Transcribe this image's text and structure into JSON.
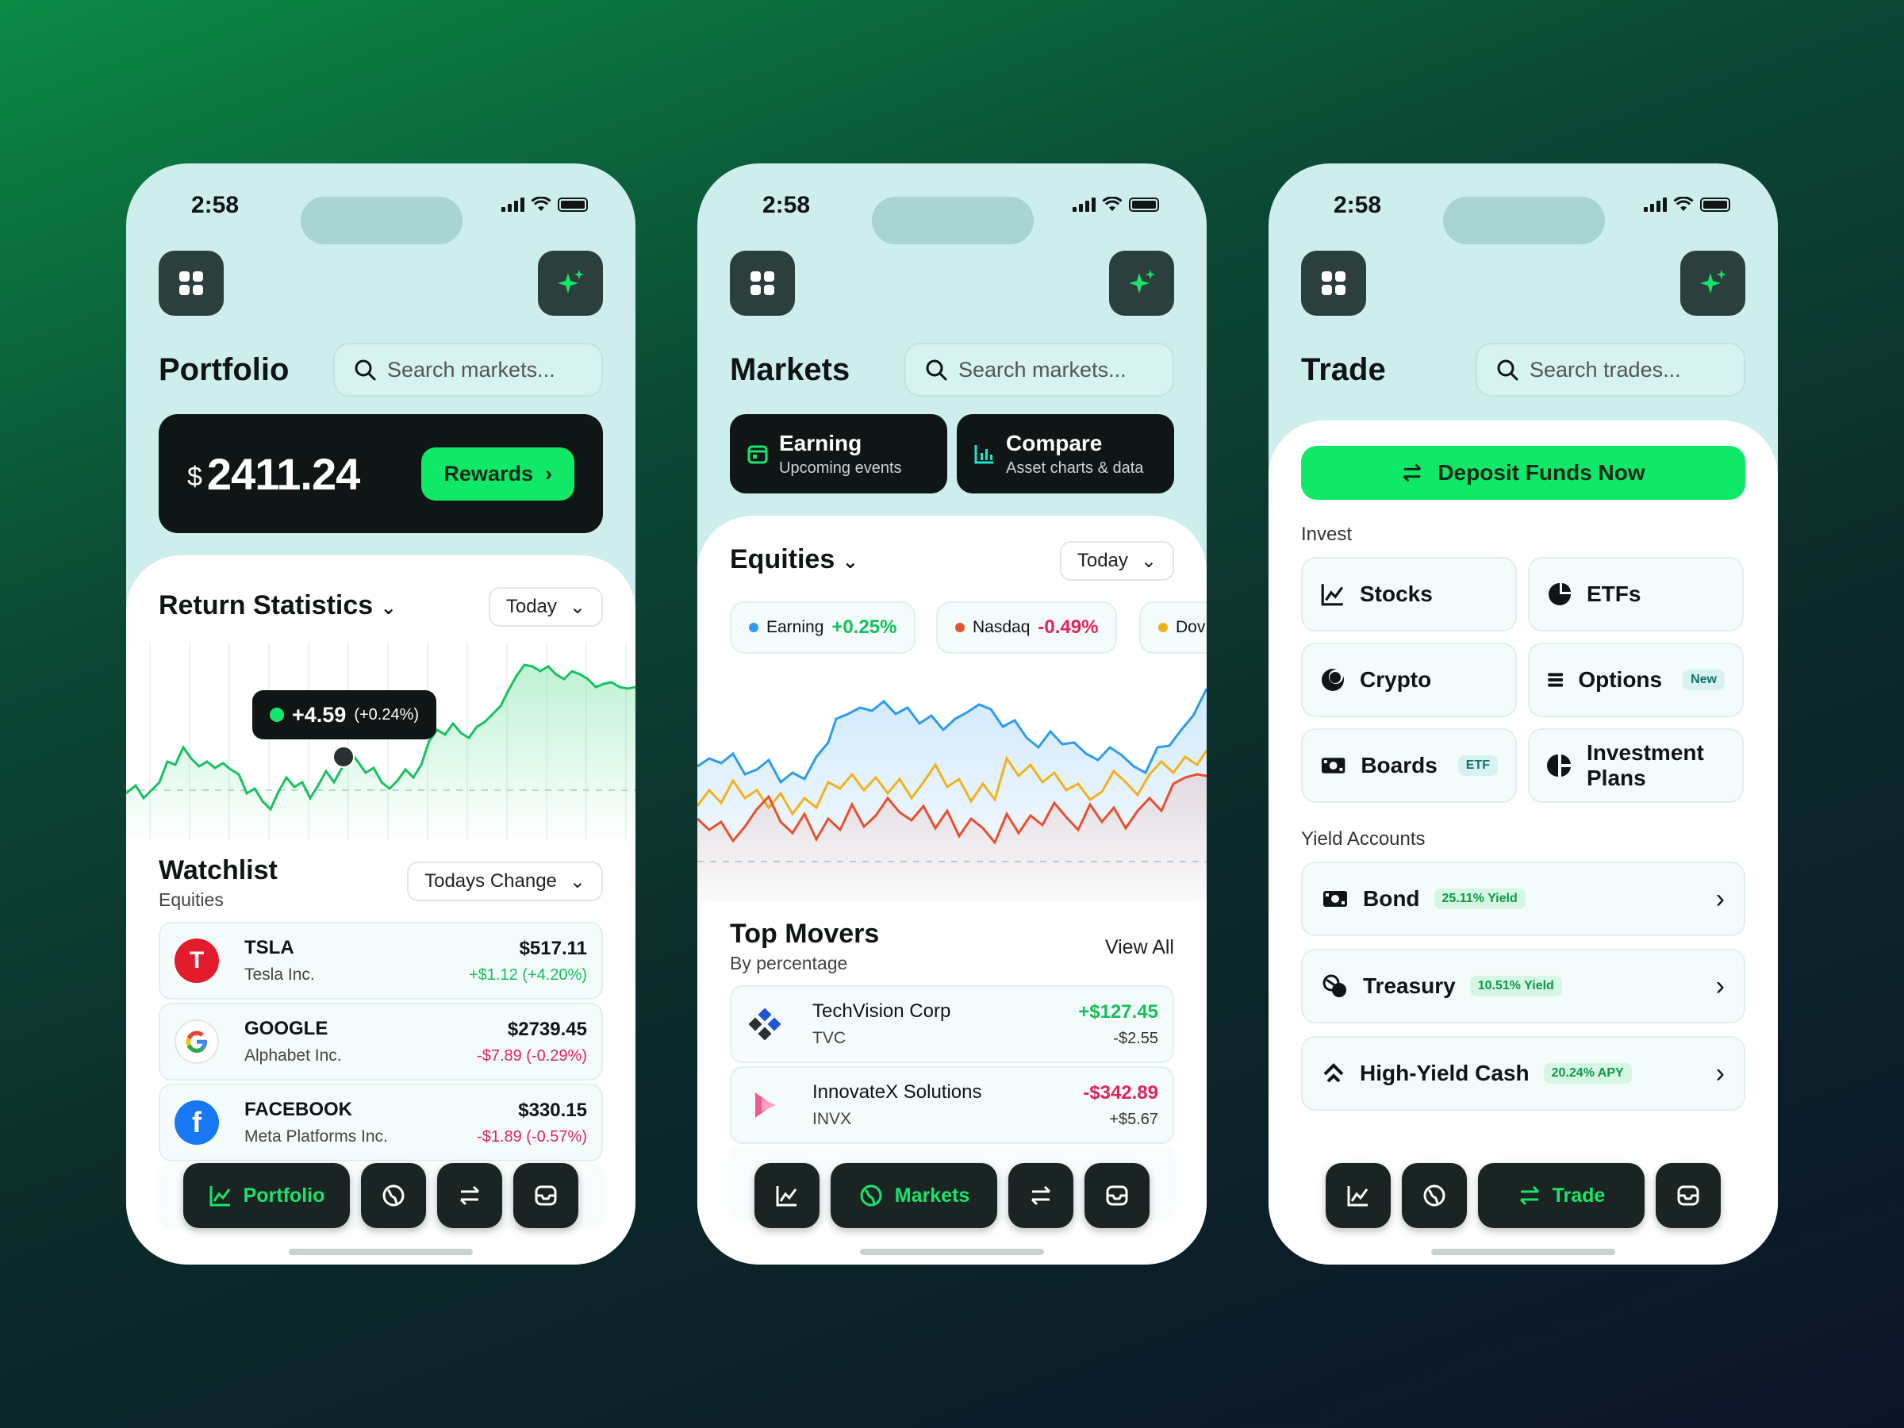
{
  "status": {
    "time": "2:58"
  },
  "portfolio": {
    "title": "Portfolio",
    "search_placeholder": "Search markets...",
    "balance_currency": "$",
    "balance_amount": "2411.24",
    "rewards_label": "Rewards",
    "return_stats_title": "Return Statistics",
    "range_label": "Today",
    "tooltip_value": "+4.59",
    "tooltip_pct": "(+0.24%)",
    "watchlist_title": "Watchlist",
    "watchlist_subtitle": "Equities",
    "watchlist_filter": "Todays Change",
    "watchlist": [
      {
        "ticker": "TSLA",
        "name": "Tesla Inc.",
        "price": "$517.11",
        "change": "+$1.12 (+4.20%)",
        "direction": "up"
      },
      {
        "ticker": "GOOGLE",
        "name": "Alphabet Inc.",
        "price": "$2739.45",
        "change": "-$7.89 (-0.29%)",
        "direction": "down"
      },
      {
        "ticker": "FACEBOOK",
        "name": "Meta Platforms Inc.",
        "price": "$330.15",
        "change": "-$1.89 (-0.57%)",
        "direction": "down"
      }
    ],
    "nav_active_label": "Portfolio"
  },
  "markets": {
    "title": "Markets",
    "search_placeholder": "Search markets...",
    "earning_title": "Earning",
    "earning_sub": "Upcoming events",
    "compare_title": "Compare",
    "compare_sub": "Asset charts & data",
    "equities_title": "Equities",
    "range_label": "Today",
    "indices": [
      {
        "name": "Earning",
        "change": "+0.25%",
        "color": "#2f9bf0",
        "direction": "up"
      },
      {
        "name": "Nasdaq",
        "change": "-0.49%",
        "color": "#e8512f",
        "direction": "down"
      },
      {
        "name": "Dov",
        "change": "",
        "color": "#f2b21b",
        "direction": "up"
      }
    ],
    "top_movers_title": "Top Movers",
    "top_movers_sub": "By percentage",
    "view_all_label": "View All",
    "movers": [
      {
        "name": "TechVision Corp",
        "ticker": "TVC",
        "price": "+$127.45",
        "change": "-$2.55",
        "direction": "up"
      },
      {
        "name": "InnovateX Solutions",
        "ticker": "INVX",
        "price": "-$342.89",
        "change": "+$5.67",
        "direction": "down"
      }
    ],
    "nav_active_label": "Markets"
  },
  "trade": {
    "title": "Trade",
    "search_placeholder": "Search trades...",
    "deposit_label": "Deposit Funds Now",
    "invest_label": "Invest",
    "invest_items": [
      {
        "label": "Stocks",
        "icon": "line-chart-icon",
        "badge": ""
      },
      {
        "label": "ETFs",
        "icon": "pie-chart-icon",
        "badge": ""
      },
      {
        "label": "Crypto",
        "icon": "crypto-icon",
        "badge": ""
      },
      {
        "label": "Options",
        "icon": "list-icon",
        "badge": "New"
      },
      {
        "label": "Boards",
        "icon": "cash-icon",
        "badge": "ETF"
      },
      {
        "label": "Investment Plans",
        "icon": "plan-pie-icon",
        "badge": ""
      }
    ],
    "yield_label": "Yield Accounts",
    "yield_items": [
      {
        "label": "Bond",
        "badge": "25.11% Yield",
        "icon": "cash-icon"
      },
      {
        "label": "Treasury",
        "badge": "10.51% Yield",
        "icon": "coins-icon"
      },
      {
        "label": "High-Yield Cash",
        "badge": "20.24% APY",
        "icon": "arrow-up-icon"
      }
    ],
    "nav_active_label": "Trade"
  },
  "colors": {
    "accent": "#10e868",
    "dark": "#101616",
    "panel_bg": "#cdeeed",
    "positive": "#12c15a",
    "negative": "#e3245a"
  }
}
